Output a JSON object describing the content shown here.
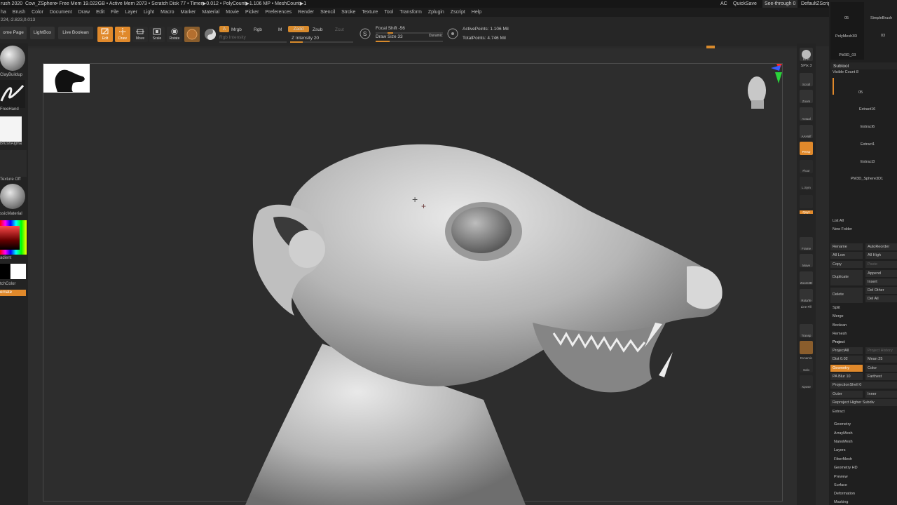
{
  "title_bar": {
    "app": "rush 2020",
    "document": "Cow_ZSphere",
    "stats": "• Free Mem 19.022GB • Active Mem 2073 • Scratch Disk 77 • Timer▶0.012 • PolyCount▶1.106 MP • MeshCount▶1",
    "ac": "AC",
    "quicksave": "QuickSave",
    "see_through": "See-through  0",
    "default_zscript": "DefaultZScript"
  },
  "menu": [
    "ha",
    "Brush",
    "Color",
    "Document",
    "Draw",
    "Edit",
    "File",
    "Layer",
    "Light",
    "Macro",
    "Marker",
    "Material",
    "Movie",
    "Picker",
    "Preferences",
    "Render",
    "Stencil",
    "Stroke",
    "Texture",
    "Tool",
    "Transform",
    "Zplugin",
    "Zscript",
    "Help"
  ],
  "coords": "224,-2.823,0.013",
  "toolbar": {
    "home_page": "ome Page",
    "lightbox": "LightBox",
    "live_boolean": "Live Boolean",
    "edit": "Edit",
    "draw": "Draw",
    "move": "Move",
    "scale": "Scale",
    "rotate": "Rotate",
    "a": "A",
    "mrgb": "Mrgb",
    "rgb": "Rgb",
    "m": "M",
    "zadd": "Zadd",
    "zsub": "Zsub",
    "zcut": "Zcut",
    "rgb_intensity": "Rgb Intensity",
    "z_intensity": "Z Intensity 20",
    "z_intensity_value": 0.2,
    "focal_shift": "Focal Shift -56",
    "draw_size": "Draw Size 33",
    "dynamic": "Dynamic",
    "active_points": "ActivePoints: 1.106 Mil",
    "total_points": "TotalPoints: 4.746 Mil"
  },
  "left_shelf": {
    "brush": "ClayBuildup",
    "stroke": "FreeHand",
    "alpha": "BrushAlpha",
    "texture": "Texture Off",
    "material": "ssicMaterial",
    "gradient": "adient",
    "switch_color": "tchColor",
    "alternate": "ernate"
  },
  "right_shelf": [
    "BPR",
    "SPix 3",
    "Scroll",
    "Zoom",
    "Actual",
    "AAHalf",
    "Persp",
    "Floor",
    "L.Sym",
    "Qxyz",
    "Frame",
    "Move",
    "Zoom3D",
    "RotaTe",
    "Line Fill",
    "Transp",
    "Dynamic",
    "Solo",
    "Xpose"
  ],
  "right_panel": {
    "top_tools": [
      "05",
      "SimpleBrush",
      "PolyMesh3D",
      "03",
      "PM3D_03"
    ],
    "subtool_title": "Subtool",
    "visible_count": "Visible Count 8",
    "subtools": [
      "05",
      "Extract16",
      "Extract6",
      "Extract1",
      "Extract3",
      "PM3D_Sphere3D1"
    ],
    "list_all": "List All",
    "new_folder": "New Folder",
    "rename": "Rename",
    "auto_reorder": "AutoReorder",
    "all_low": "All Low",
    "all_high": "All High",
    "copy": "Copy",
    "paste": "Paste",
    "duplicate": "Duplicate",
    "append": "Append",
    "insert": "Insert",
    "delete": "Delete",
    "del_other": "Del Other",
    "del_all": "Del All",
    "split": "Split",
    "merge": "Merge",
    "boolean": "Boolean",
    "remesh": "Remesh",
    "project": "Project",
    "project_all": "ProjectAll",
    "project_history": "Project History",
    "dist": "Dist 0.02",
    "mean": "Mean 25",
    "geometry_btn": "Geometry",
    "color_btn": "Color",
    "pa_blur": "PA Blur 10",
    "farthest": "Farthest",
    "projection_shell": "ProjectionShell 0",
    "outer": "Outer",
    "inner": "Inner",
    "reproject": "Reproject Higher Subdiv",
    "extract": "Extract",
    "sections": [
      "Geometry",
      "ArrayMesh",
      "NanoMesh",
      "Layers",
      "FiberMesh",
      "Geometry HD",
      "Preview",
      "Surface",
      "Deformation",
      "Masking"
    ]
  },
  "colors": {
    "accent": "#e0892b",
    "bg": "#2d2d2d"
  }
}
